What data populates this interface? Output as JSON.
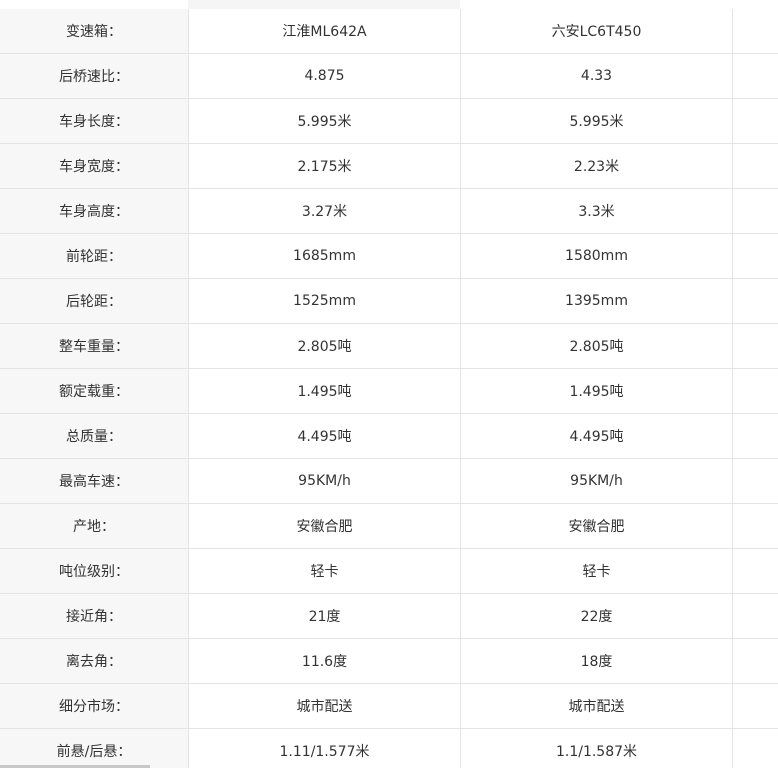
{
  "rows": [
    {
      "label": "变速箱：",
      "a": "江淮ML642A",
      "b": "六安LC6T450"
    },
    {
      "label": "后桥速比：",
      "a": "4.875",
      "b": "4.33"
    },
    {
      "label": "车身长度：",
      "a": "5.995米",
      "b": "5.995米"
    },
    {
      "label": "车身宽度：",
      "a": "2.175米",
      "b": "2.23米"
    },
    {
      "label": "车身高度：",
      "a": "3.27米",
      "b": "3.3米"
    },
    {
      "label": "前轮距：",
      "a": "1685mm",
      "b": "1580mm"
    },
    {
      "label": "后轮距：",
      "a": "1525mm",
      "b": "1395mm"
    },
    {
      "label": "整车重量：",
      "a": "2.805吨",
      "b": "2.805吨"
    },
    {
      "label": "额定载重：",
      "a": "1.495吨",
      "b": "1.495吨"
    },
    {
      "label": "总质量：",
      "a": "4.495吨",
      "b": "4.495吨"
    },
    {
      "label": "最高车速：",
      "a": "95KM/h",
      "b": "95KM/h"
    },
    {
      "label": "产地：",
      "a": "安徽合肥",
      "b": "安徽合肥"
    },
    {
      "label": "吨位级别：",
      "a": "轻卡",
      "b": "轻卡"
    },
    {
      "label": "接近角：",
      "a": "21度",
      "b": "22度"
    },
    {
      "label": "离去角：",
      "a": "11.6度",
      "b": "18度"
    },
    {
      "label": "细分市场：",
      "a": "城市配送",
      "b": "城市配送"
    },
    {
      "label": "前悬/后悬：",
      "a": "1.11/1.577米",
      "b": "1.1/1.587米"
    }
  ]
}
